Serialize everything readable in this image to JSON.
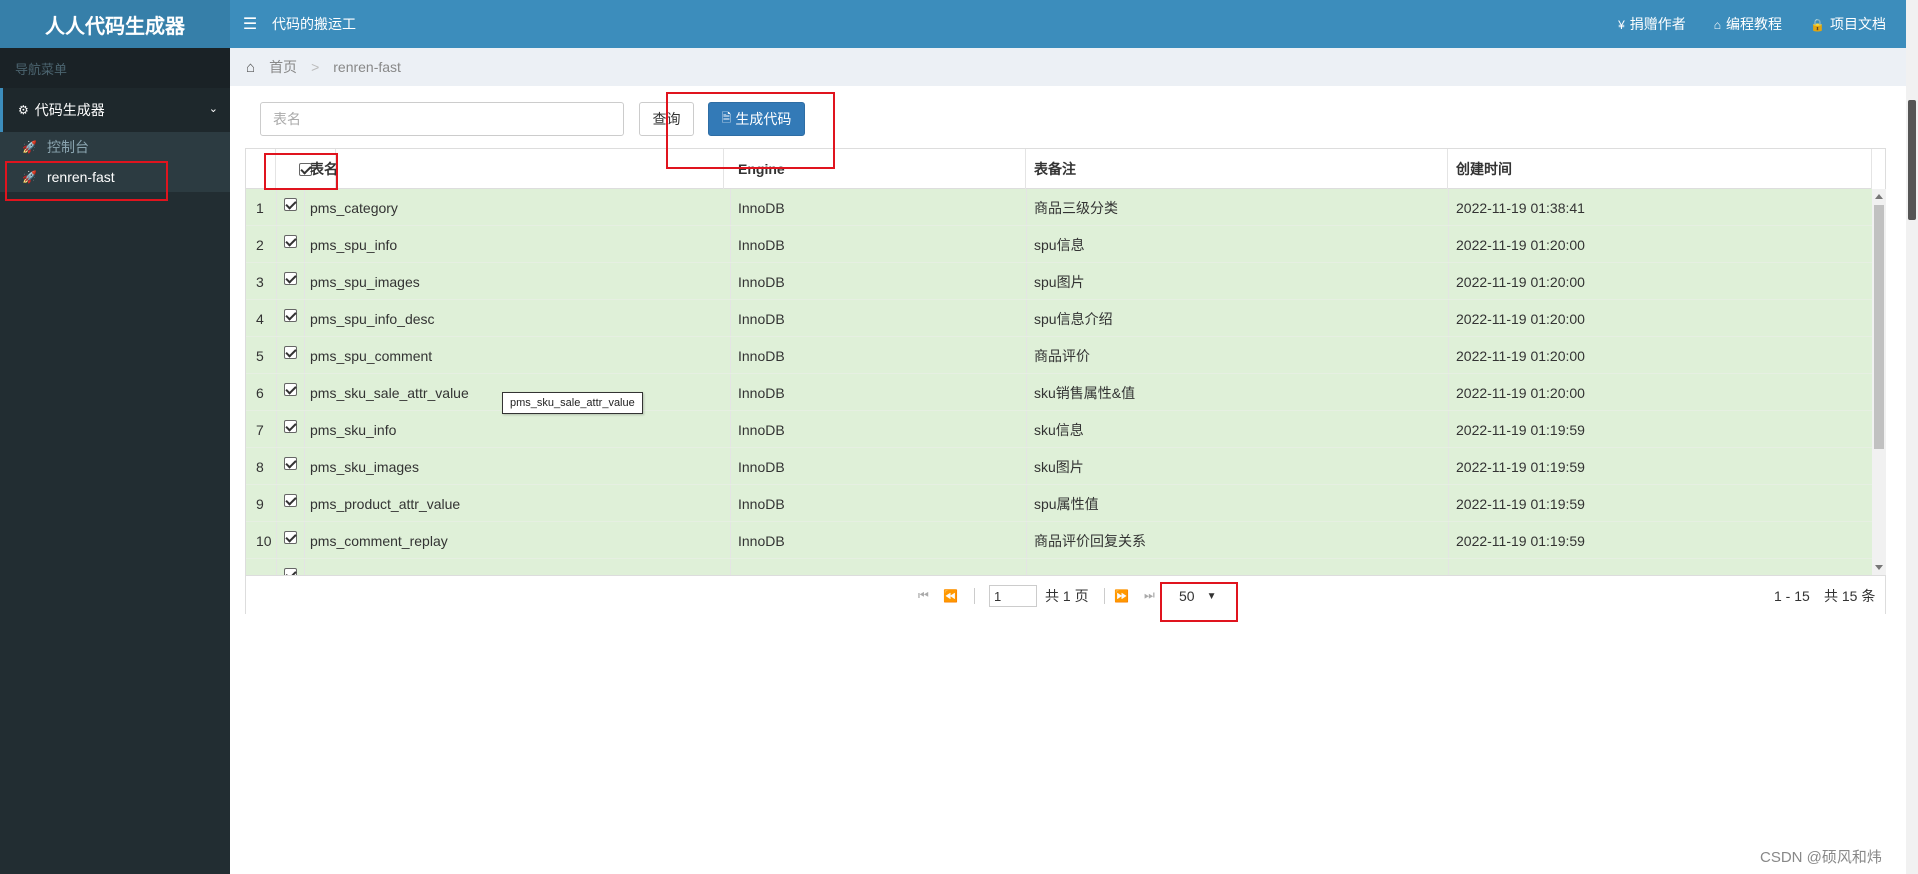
{
  "app": {
    "logo": "人人代码生成器",
    "header_title": "代码的搬运工"
  },
  "header_links": [
    {
      "icon": "yen-icon",
      "glyph": "¥",
      "label": "捐赠作者"
    },
    {
      "icon": "home-icon",
      "glyph": "⌂",
      "label": "编程教程"
    },
    {
      "icon": "lock-icon",
      "glyph": "🔒",
      "label": "项目文档"
    }
  ],
  "sidebar": {
    "header": "导航菜单",
    "parent": "代码生成器",
    "items": [
      {
        "label": "控制台",
        "active": false
      },
      {
        "label": "renren-fast",
        "active": true
      }
    ]
  },
  "breadcrumb": {
    "home": "首页",
    "current": "renren-fast"
  },
  "toolbar": {
    "search_placeholder": "表名",
    "query_label": "查询",
    "generate_label": "生成代码"
  },
  "table": {
    "columns": [
      "表名",
      "Engine",
      "表备注",
      "创建时间"
    ],
    "rows": [
      {
        "n": "1",
        "name": "pms_category",
        "engine": "InnoDB",
        "comment": "商品三级分类",
        "time": "2022-11-19 01:38:41"
      },
      {
        "n": "2",
        "name": "pms_spu_info",
        "engine": "InnoDB",
        "comment": "spu信息",
        "time": "2022-11-19 01:20:00"
      },
      {
        "n": "3",
        "name": "pms_spu_images",
        "engine": "InnoDB",
        "comment": "spu图片",
        "time": "2022-11-19 01:20:00"
      },
      {
        "n": "4",
        "name": "pms_spu_info_desc",
        "engine": "InnoDB",
        "comment": "spu信息介绍",
        "time": "2022-11-19 01:20:00"
      },
      {
        "n": "5",
        "name": "pms_spu_comment",
        "engine": "InnoDB",
        "comment": "商品评价",
        "time": "2022-11-19 01:20:00"
      },
      {
        "n": "6",
        "name": "pms_sku_sale_attr_value",
        "engine": "InnoDB",
        "comment": "sku销售属性&值",
        "time": "2022-11-19 01:20:00"
      },
      {
        "n": "7",
        "name": "pms_sku_info",
        "engine": "InnoDB",
        "comment": "sku信息",
        "time": "2022-11-19 01:19:59"
      },
      {
        "n": "8",
        "name": "pms_sku_images",
        "engine": "InnoDB",
        "comment": "sku图片",
        "time": "2022-11-19 01:19:59"
      },
      {
        "n": "9",
        "name": "pms_product_attr_value",
        "engine": "InnoDB",
        "comment": "spu属性值",
        "time": "2022-11-19 01:19:59"
      },
      {
        "n": "10",
        "name": "pms_comment_replay",
        "engine": "InnoDB",
        "comment": "商品评价回复关系",
        "time": "2022-11-19 01:19:59"
      }
    ],
    "tooltip": "pms_sku_sale_attr_value"
  },
  "pager": {
    "page": "1",
    "total_pages": "共 1 页",
    "page_size": "50",
    "range": "1 - 15",
    "total": "共 15 条"
  },
  "watermark": "CSDN @硕风和炜",
  "colors": {
    "header": "#3c8dbc",
    "logo": "#367fa9",
    "sidebar": "#222d32",
    "row_selected": "#dff0d8",
    "primary_button": "#337ab7",
    "annotation": "#e0141e"
  }
}
